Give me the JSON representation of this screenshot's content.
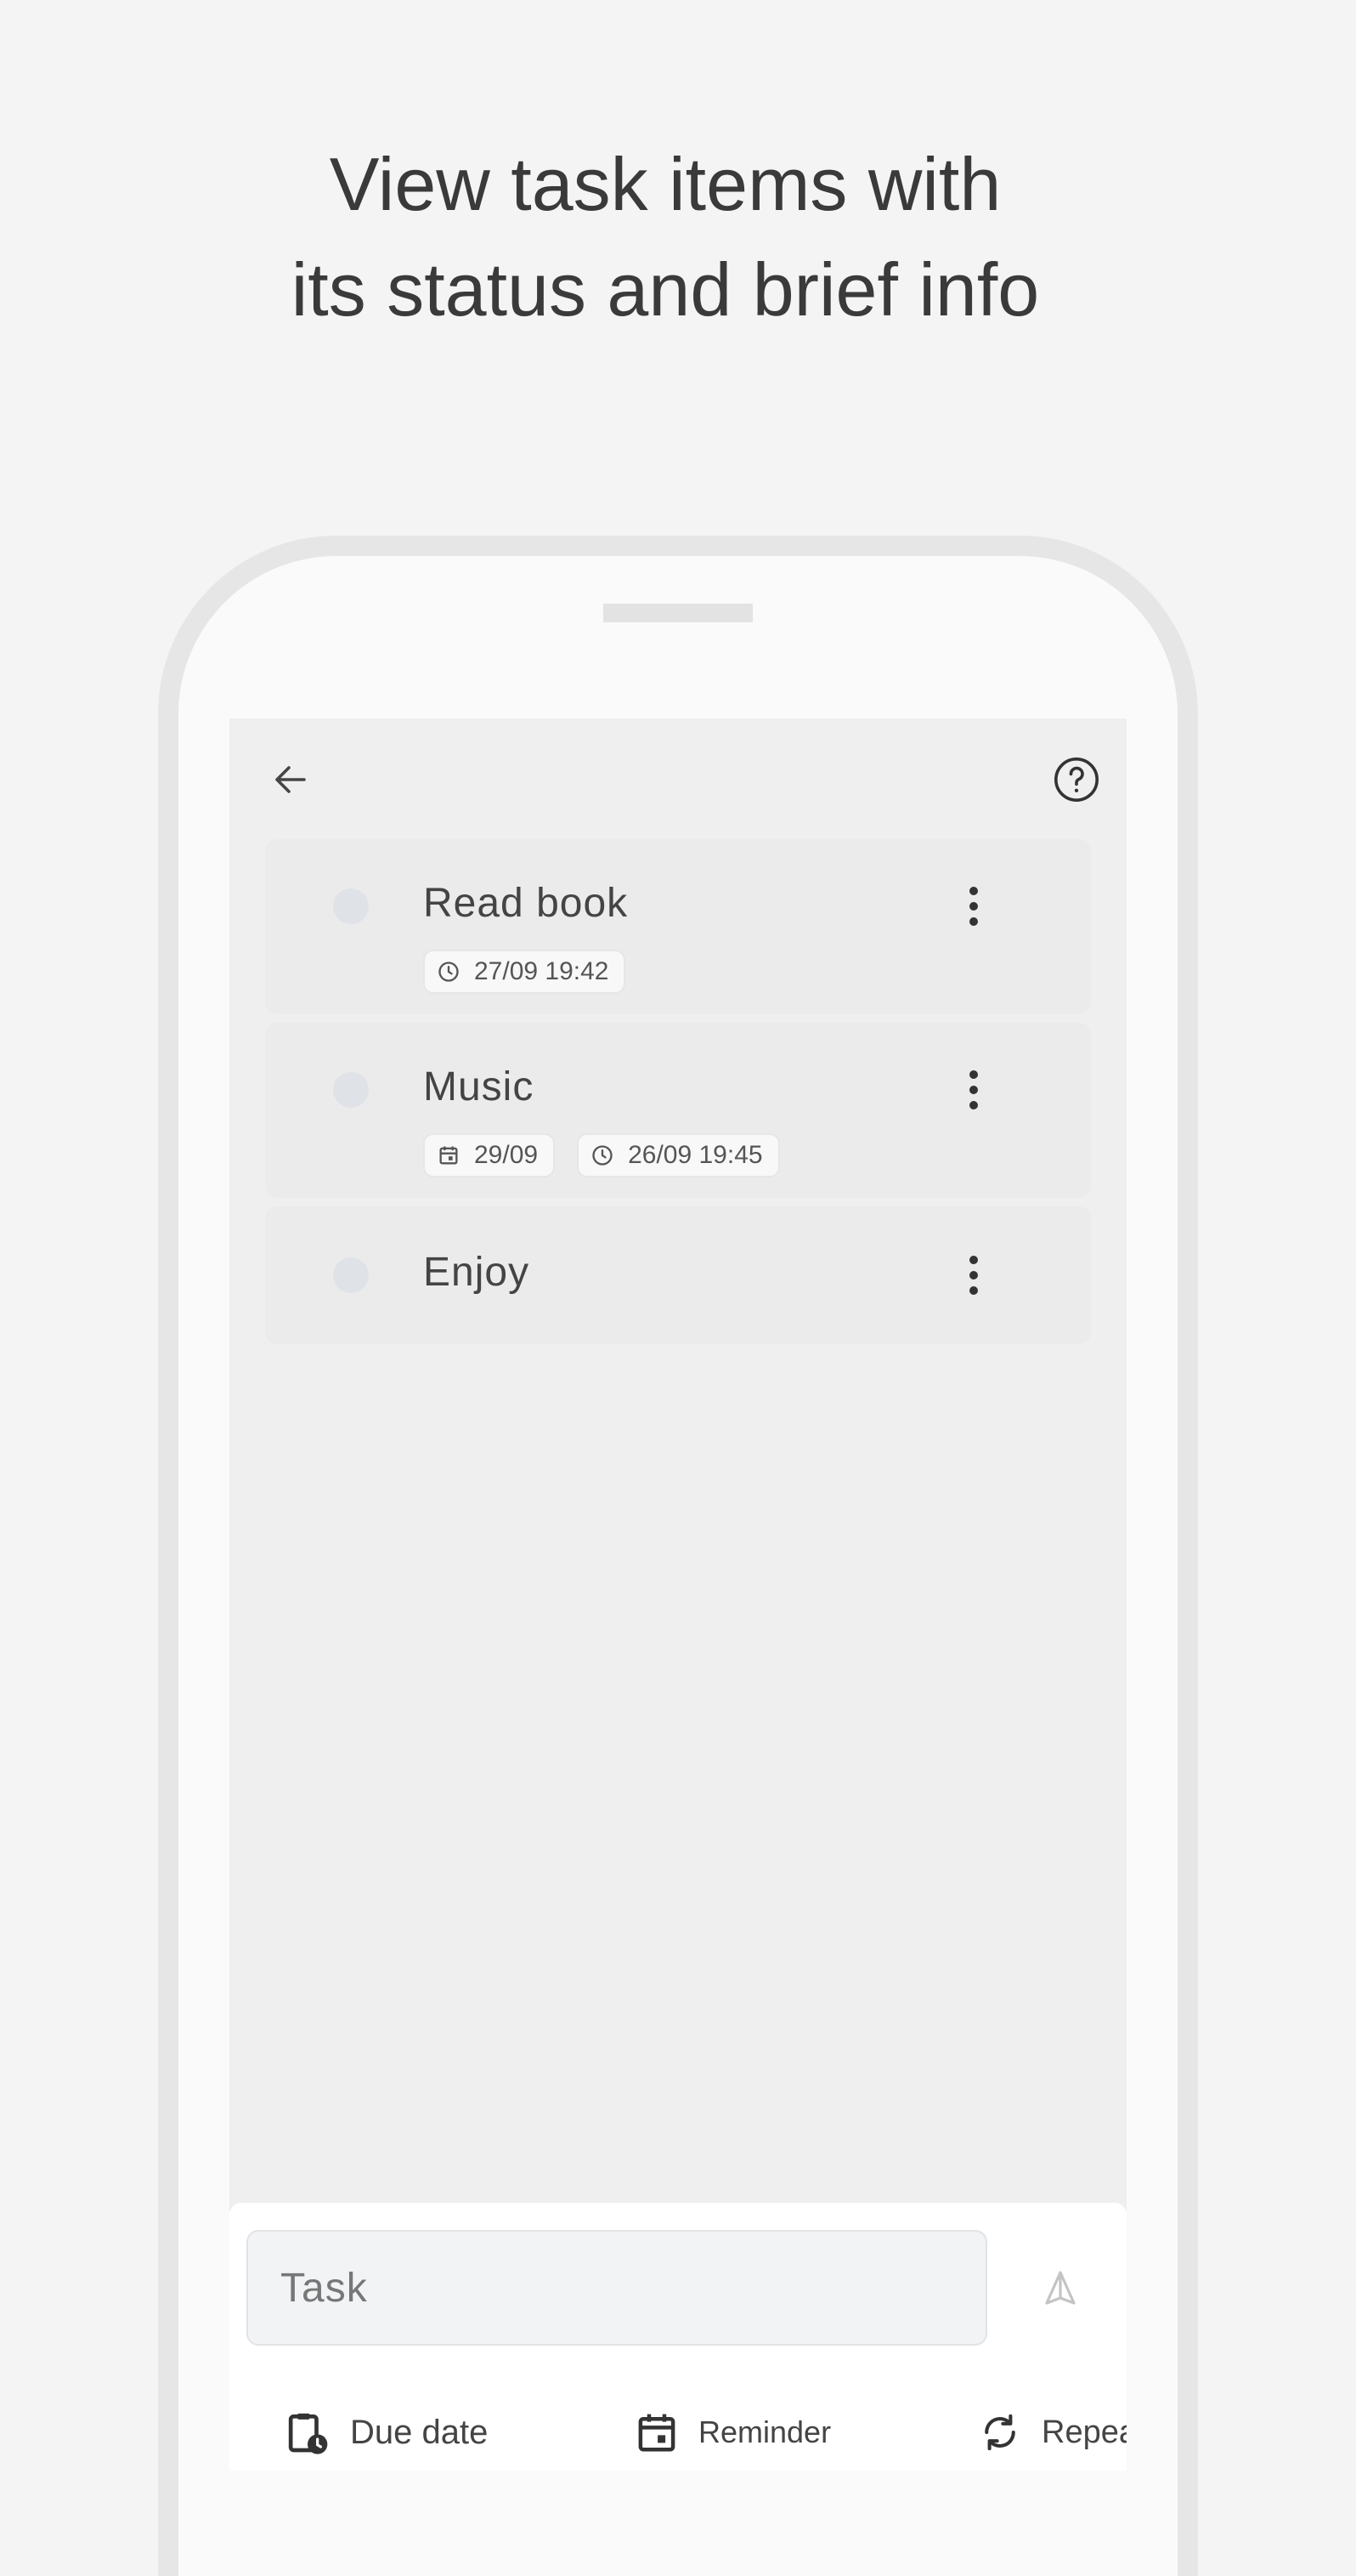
{
  "headline": {
    "line1": "View task items with",
    "line2": "its status and brief info"
  },
  "colors": {
    "background": "#f4f4f4",
    "screen": "#efefef",
    "card": "#ebebeb",
    "text": "#444444",
    "status_dot": "#dfe2e6"
  },
  "toolbar": {
    "back_icon": "arrow-left-icon",
    "help_icon": "help-circle-icon"
  },
  "tasks": [
    {
      "title": "Read book",
      "chips": [
        {
          "icon": "clock-icon",
          "text": "27/09 19:42"
        }
      ]
    },
    {
      "title": "Music",
      "chips": [
        {
          "icon": "calendar-icon",
          "text": "29/09"
        },
        {
          "icon": "clock-icon",
          "text": "26/09 19:45"
        }
      ]
    },
    {
      "title": "Enjoy",
      "chips": []
    }
  ],
  "composer": {
    "placeholder": "Task",
    "send_icon": "send-icon",
    "actions": [
      {
        "label": "Due date",
        "icon": "clipboard-clock-icon"
      },
      {
        "label": "Reminder",
        "icon": "calendar-event-icon"
      },
      {
        "label": "Repeat",
        "icon": "repeat-icon"
      }
    ]
  }
}
